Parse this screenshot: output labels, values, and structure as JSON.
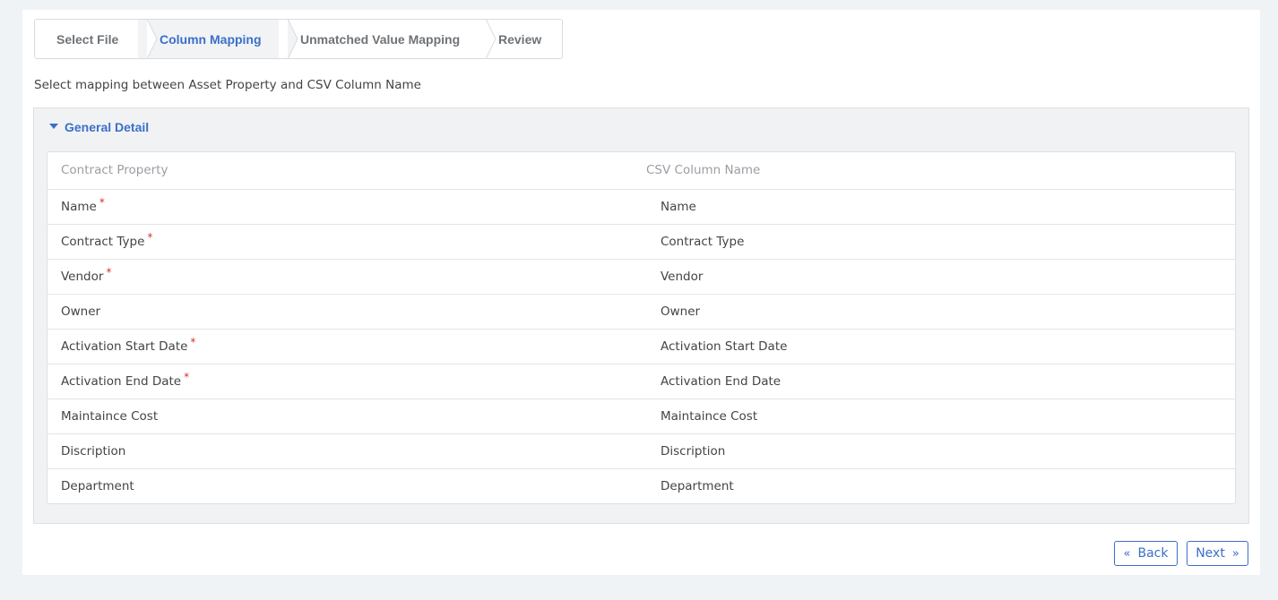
{
  "wizard": {
    "steps": [
      {
        "label": "Select File",
        "active": false
      },
      {
        "label": "Column Mapping",
        "active": true
      },
      {
        "label": "Unmatched Value Mapping",
        "active": false
      },
      {
        "label": "Review",
        "active": false
      }
    ]
  },
  "description": "Select mapping between Asset Property and CSV Column Name",
  "section": {
    "title": "General Detail",
    "expanded": true,
    "headers": {
      "property": "Contract Property",
      "csv": "CSV Column Name"
    },
    "rows": [
      {
        "property": "Name",
        "required": true,
        "csv": "Name"
      },
      {
        "property": "Contract Type",
        "required": true,
        "csv": "Contract Type"
      },
      {
        "property": "Vendor",
        "required": true,
        "csv": "Vendor"
      },
      {
        "property": "Owner",
        "required": false,
        "csv": "Owner"
      },
      {
        "property": "Activation Start Date",
        "required": true,
        "csv": "Activation Start Date"
      },
      {
        "property": "Activation End Date",
        "required": true,
        "csv": "Activation End Date"
      },
      {
        "property": "Maintaince Cost",
        "required": false,
        "csv": "Maintaince Cost"
      },
      {
        "property": "Discription",
        "required": false,
        "csv": "Discription"
      },
      {
        "property": "Department",
        "required": false,
        "csv": "Department"
      }
    ]
  },
  "buttons": {
    "back_label": "Back",
    "back_icon": "double-chevron-left-icon",
    "next_label": "Next",
    "next_icon": "double-chevron-right-icon"
  },
  "colors": {
    "accent": "#3b6fc9",
    "required": "#d0342c",
    "page_bg": "#f0f3f6"
  }
}
